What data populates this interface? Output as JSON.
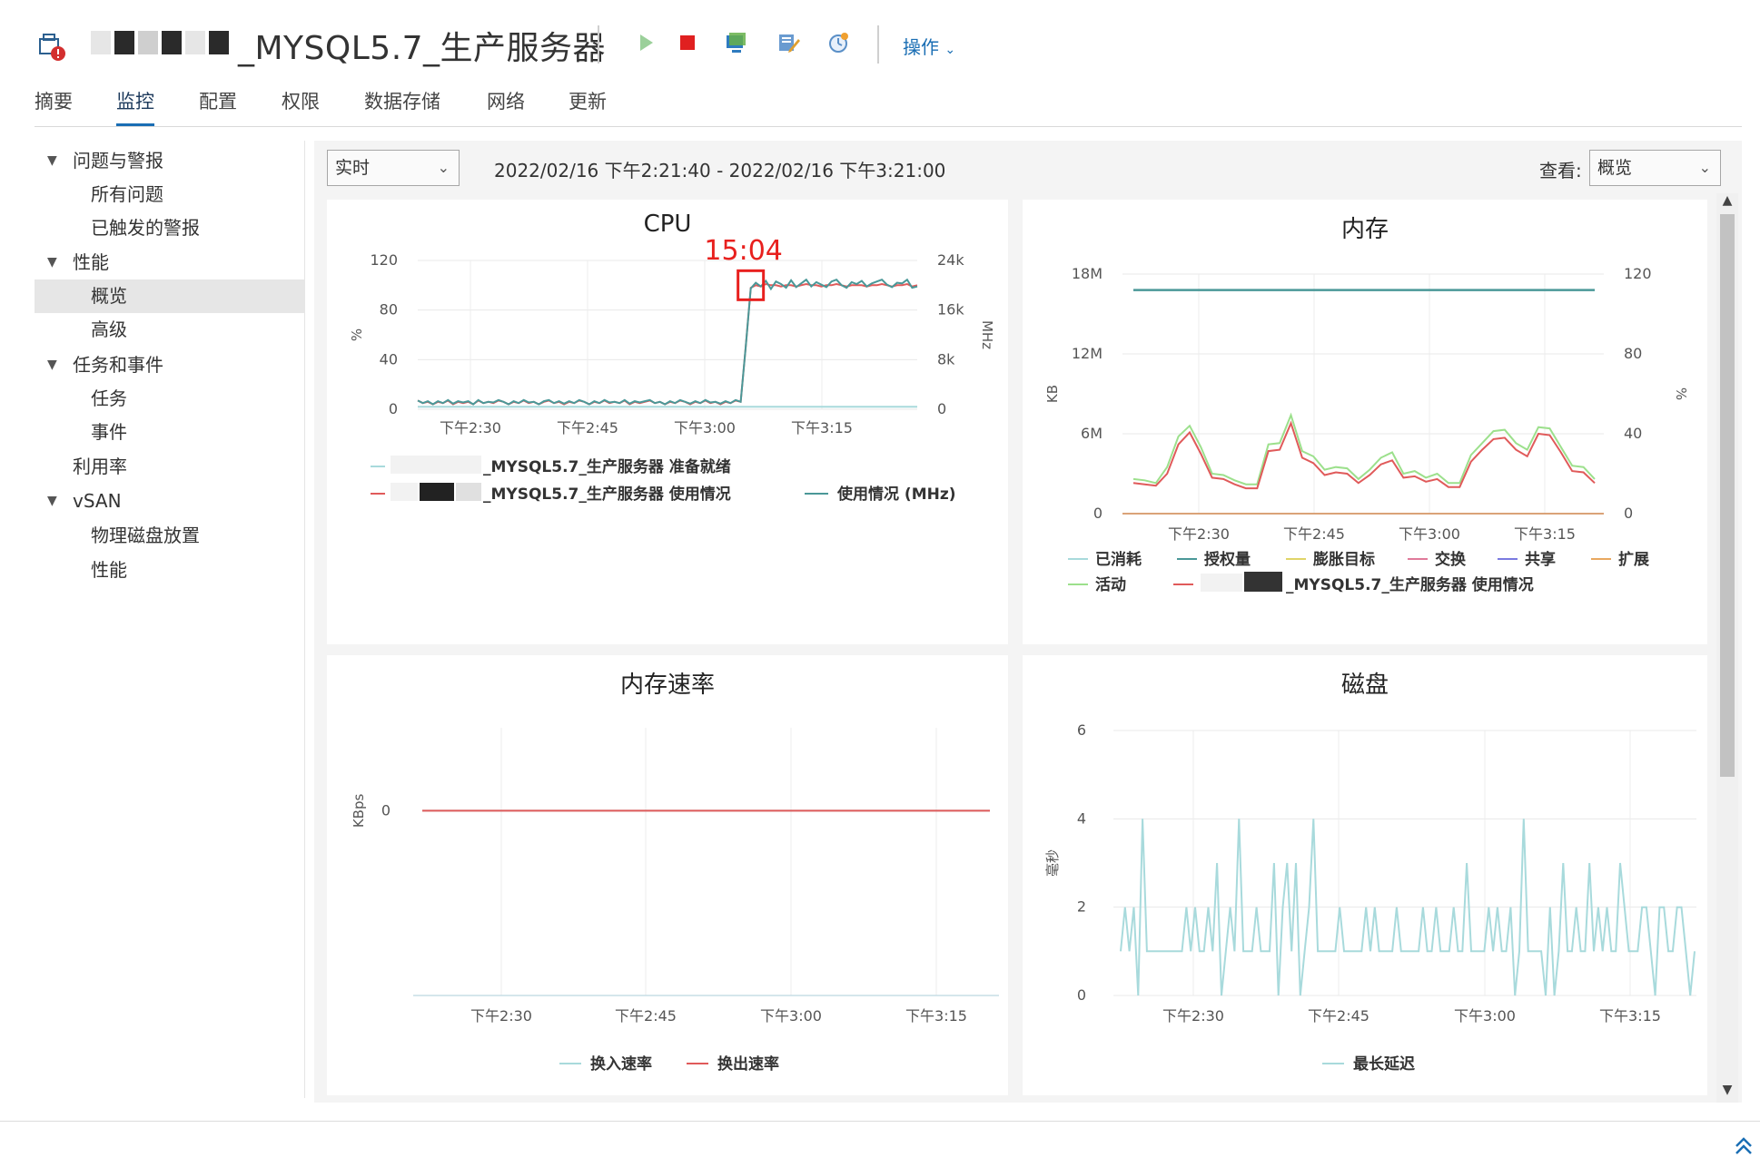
{
  "header": {
    "title": "_MYSQL5.7_生产服务器",
    "actions_label": "操作",
    "toolbar_icons": [
      "vm-alert-icon",
      "power-on-icon",
      "power-off-icon",
      "console-icon",
      "edit-settings-icon",
      "snapshot-icon"
    ]
  },
  "tabs": [
    {
      "label": "摘要",
      "active": false
    },
    {
      "label": "监控",
      "active": true
    },
    {
      "label": "配置",
      "active": false
    },
    {
      "label": "权限",
      "active": false
    },
    {
      "label": "数据存储",
      "active": false
    },
    {
      "label": "网络",
      "active": false
    },
    {
      "label": "更新",
      "active": false
    }
  ],
  "sidebar": {
    "items": [
      {
        "label": "问题与警报",
        "level": 0,
        "expanded": true
      },
      {
        "label": "所有问题",
        "level": 1
      },
      {
        "label": "已触发的警报",
        "level": 1
      },
      {
        "label": "性能",
        "level": 0,
        "expanded": true
      },
      {
        "label": "概览",
        "level": 1,
        "selected": true
      },
      {
        "label": "高级",
        "level": 1
      },
      {
        "label": "任务和事件",
        "level": 0,
        "expanded": true
      },
      {
        "label": "任务",
        "level": 1
      },
      {
        "label": "事件",
        "level": 1
      },
      {
        "label": "利用率",
        "level": 0
      },
      {
        "label": "vSAN",
        "level": 0,
        "expanded": true
      },
      {
        "label": "物理磁盘放置",
        "level": 1
      },
      {
        "label": "性能",
        "level": 1
      }
    ]
  },
  "toolbar": {
    "range": "实时",
    "timespan": "2022/02/16 下午2:21:40 - 2022/02/16 下午3:21:00",
    "view_label": "查看:",
    "view": "概览"
  },
  "colors": {
    "accent": "#1a6eb4",
    "teal": "#4a9898",
    "red": "#e05a5a",
    "light_teal": "#a8dadc",
    "green": "#9ce08c",
    "annotation": "#e8201e"
  },
  "chart_data": [
    {
      "type": "line",
      "title": "CPU",
      "x_ticks": [
        "下午2:30",
        "下午2:45",
        "下午3:00",
        "下午3:15"
      ],
      "y_left": {
        "label": "%",
        "ticks": [
          "0",
          "40",
          "80",
          "120"
        ],
        "lim": [
          0,
          120
        ]
      },
      "y_right": {
        "label": "MHz",
        "ticks": [
          "0",
          "8k",
          "16k",
          "24k"
        ],
        "lim": [
          0,
          24000
        ]
      },
      "annotation": "15:04",
      "series": [
        {
          "name": "_MYSQL5.7_生产服务器 准备就绪",
          "color": "#a8dadc",
          "values": [
            2,
            2,
            2,
            2,
            2,
            2,
            2,
            2,
            2,
            2,
            2,
            2,
            2,
            2,
            2,
            2,
            2,
            2,
            2,
            2,
            2,
            2,
            2,
            2,
            2,
            2,
            2,
            2,
            2,
            2,
            2,
            2,
            2,
            2,
            2,
            2,
            2,
            2,
            2,
            2,
            2,
            2,
            2,
            2,
            2,
            2,
            2,
            2,
            2,
            2,
            2,
            2,
            2,
            2,
            2,
            2,
            2,
            2,
            2,
            2,
            2,
            2,
            2,
            2,
            2,
            2,
            2,
            2,
            2,
            2,
            2,
            2,
            2,
            2,
            2,
            2,
            2,
            2,
            2,
            2,
            2,
            2,
            2,
            2,
            2,
            2,
            2,
            2,
            2,
            2,
            2,
            2,
            2,
            2,
            2,
            2,
            2,
            2,
            2,
            2
          ]
        },
        {
          "name": "_MYSQL5.7_生产服务器 使用情况",
          "color": "#e05a5a",
          "values": [
            7,
            5,
            6,
            4,
            6,
            5,
            7,
            4,
            6,
            5,
            6,
            4,
            7,
            5,
            6,
            5,
            7,
            6,
            4,
            6,
            5,
            7,
            5,
            6,
            4,
            6,
            7,
            5,
            6,
            4,
            6,
            5,
            7,
            6,
            4,
            6,
            5,
            7,
            5,
            6,
            5,
            7,
            4,
            6,
            5,
            6,
            7,
            5,
            6,
            4,
            6,
            5,
            7,
            6,
            4,
            6,
            5,
            7,
            5,
            6,
            4,
            6,
            5,
            7,
            6,
            50,
            98,
            100,
            99,
            101,
            100,
            100,
            99,
            100,
            100,
            99,
            100,
            101,
            100,
            100,
            99,
            100,
            100,
            101,
            100,
            99,
            100,
            100,
            100,
            99,
            100,
            100,
            101,
            100,
            99,
            100,
            100,
            101,
            99,
            100
          ]
        },
        {
          "name": "使用情况 (MHz)",
          "color": "#4a9898",
          "values": [
            1400,
            1000,
            1300,
            800,
            1300,
            1000,
            1500,
            900,
            1300,
            1100,
            1300,
            800,
            1500,
            1000,
            1200,
            1100,
            1500,
            1200,
            800,
            1300,
            1000,
            1500,
            1100,
            1200,
            800,
            1300,
            1500,
            1000,
            1300,
            900,
            1300,
            1000,
            1500,
            1200,
            800,
            1300,
            1000,
            1500,
            1100,
            1200,
            1000,
            1500,
            900,
            1300,
            1100,
            1300,
            1500,
            1000,
            1200,
            800,
            1300,
            1000,
            1500,
            1200,
            900,
            1300,
            1000,
            1500,
            1100,
            1200,
            900,
            1300,
            1000,
            1500,
            1200,
            10000,
            19500,
            20400,
            19800,
            20700,
            19400,
            20600,
            20200,
            19600,
            20800,
            19700,
            20300,
            20900,
            19800,
            20500,
            20100,
            19700,
            20600,
            20900,
            20000,
            19600,
            20500,
            20200,
            20700,
            19800,
            20300,
            20600,
            20900,
            20100,
            19700,
            20400,
            20300,
            20900,
            19600,
            19800
          ]
        }
      ]
    },
    {
      "type": "line",
      "title": "内存",
      "x_ticks": [
        "下午2:30",
        "下午2:45",
        "下午3:00",
        "下午3:15"
      ],
      "y_left": {
        "label": "KB",
        "ticks": [
          "0",
          "6M",
          "12M",
          "18M"
        ],
        "lim": [
          0,
          18000000
        ]
      },
      "y_right": {
        "label": "%",
        "ticks": [
          "0",
          "40",
          "80",
          "120"
        ],
        "lim": [
          0,
          120
        ]
      },
      "series": [
        {
          "name": "已消耗",
          "color": "#a8dadc",
          "values": []
        },
        {
          "name": "授权量",
          "color": "#4a9898",
          "values": [
            16800000,
            16800000
          ]
        },
        {
          "name": "膨胀目标",
          "color": "#e0d468",
          "values": [
            0,
            0
          ]
        },
        {
          "name": "交换",
          "color": "#e07a9a",
          "values": [
            0,
            0
          ]
        },
        {
          "name": "共享",
          "color": "#7a7ae0",
          "values": [
            0,
            0
          ]
        },
        {
          "name": "扩展",
          "color": "#e8a860",
          "values": [
            0,
            0
          ]
        },
        {
          "name": "活动",
          "color": "#9ce08c",
          "values": [
            2600000,
            2500000,
            2300000,
            3500000,
            5800000,
            6600000,
            5000000,
            3000000,
            2900000,
            2500000,
            2200000,
            2200000,
            5200000,
            5300000,
            7400000,
            4700000,
            4300000,
            3300000,
            3500000,
            3400000,
            2600000,
            3300000,
            4200000,
            4600000,
            3000000,
            3200000,
            2700000,
            3000000,
            2300000,
            2300000,
            4400000,
            5300000,
            6200000,
            6300000,
            5300000,
            4800000,
            6500000,
            6400000,
            5000000,
            3600000,
            3500000,
            2600000
          ]
        },
        {
          "name": "_MYSQL5.7_生产服务器 使用情况",
          "color": "#e05a5a",
          "values": [
            2300000,
            2200000,
            2100000,
            3000000,
            5200000,
            6100000,
            4500000,
            2700000,
            2600000,
            2200000,
            1900000,
            1900000,
            4700000,
            4800000,
            6800000,
            4200000,
            3800000,
            2900000,
            3100000,
            3000000,
            2300000,
            2900000,
            3700000,
            4000000,
            2700000,
            2800000,
            2400000,
            2600000,
            2000000,
            2000000,
            3900000,
            4800000,
            5600000,
            5700000,
            4800000,
            4300000,
            6000000,
            5900000,
            4600000,
            3200000,
            3100000,
            2300000
          ]
        }
      ]
    },
    {
      "type": "line",
      "title": "内存速率",
      "x_ticks": [
        "下午2:30",
        "下午2:45",
        "下午3:00",
        "下午3:15"
      ],
      "y_left": {
        "label": "KBps",
        "ticks": [
          "0"
        ]
      },
      "series": [
        {
          "name": "换入速率",
          "color": "#a8dadc",
          "values": [
            0,
            0
          ]
        },
        {
          "name": "换出速率",
          "color": "#e05a5a",
          "values": [
            0,
            0
          ]
        }
      ]
    },
    {
      "type": "line",
      "title": "磁盘",
      "x_ticks": [
        "下午2:30",
        "下午2:45",
        "下午3:00",
        "下午3:15"
      ],
      "y_left": {
        "label": "毫秒",
        "ticks": [
          "0",
          "2",
          "4",
          "6"
        ],
        "lim": [
          0,
          6
        ]
      },
      "series": [
        {
          "name": "最长延迟",
          "color": "#a8dadc",
          "values": [
            1,
            2,
            1,
            2,
            0,
            4,
            1,
            1,
            1,
            1,
            1,
            1,
            1,
            1,
            1,
            2,
            1,
            2,
            1,
            1,
            2,
            1,
            3,
            0,
            1,
            2,
            1,
            4,
            1,
            1,
            1,
            2,
            1,
            1,
            1,
            3,
            0,
            2,
            3,
            1,
            3,
            0,
            1,
            2,
            4,
            1,
            1,
            1,
            1,
            1,
            2,
            1,
            1,
            1,
            1,
            1,
            2,
            1,
            2,
            1,
            1,
            1,
            1,
            2,
            1,
            1,
            1,
            1,
            1,
            2,
            1,
            1,
            2,
            1,
            1,
            1,
            2,
            1,
            1,
            3,
            1,
            1,
            1,
            1,
            2,
            1,
            2,
            1,
            1,
            2,
            0,
            1,
            4,
            1,
            1,
            1,
            1,
            0,
            2,
            0,
            1,
            3,
            1,
            1,
            2,
            1,
            1,
            3,
            1,
            2,
            1,
            2,
            1,
            1,
            3,
            2,
            1,
            1,
            1,
            2,
            2,
            1,
            0,
            2,
            2,
            1,
            1,
            2,
            2,
            1,
            0,
            1
          ]
        }
      ]
    }
  ]
}
